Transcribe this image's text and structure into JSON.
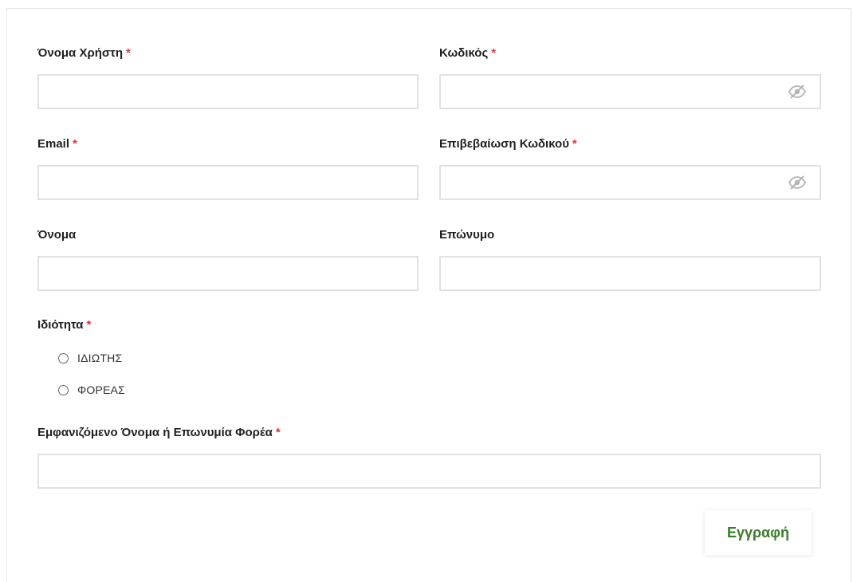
{
  "form": {
    "required_mark": "*",
    "username": {
      "label": "Όνομα Χρήστη",
      "value": ""
    },
    "password": {
      "label": "Κωδικός",
      "value": ""
    },
    "email": {
      "label": "Email",
      "value": ""
    },
    "confirm_password": {
      "label": "Επιβεβαίωση Κωδικού",
      "value": ""
    },
    "first_name": {
      "label": "Όνομα",
      "value": ""
    },
    "last_name": {
      "label": "Επώνυμο",
      "value": ""
    },
    "role": {
      "label": "Ιδιότητα",
      "options": [
        {
          "label": "ΙΔΙΩΤΗΣ",
          "selected": false
        },
        {
          "label": "ΦΟΡΕΑΣ",
          "selected": false
        }
      ]
    },
    "display_name": {
      "label": "Εμφανιζόμενο Όνομα ή Επωνυμία Φορέα",
      "value": ""
    },
    "submit_label": "Εγγραφή"
  },
  "icons": {
    "password_toggle": "eye-slash-icon"
  },
  "colors": {
    "required": "#e0343b",
    "button_text": "#3c7a2c",
    "input_border": "#e2e2e2",
    "icon": "#b5b5b5"
  }
}
